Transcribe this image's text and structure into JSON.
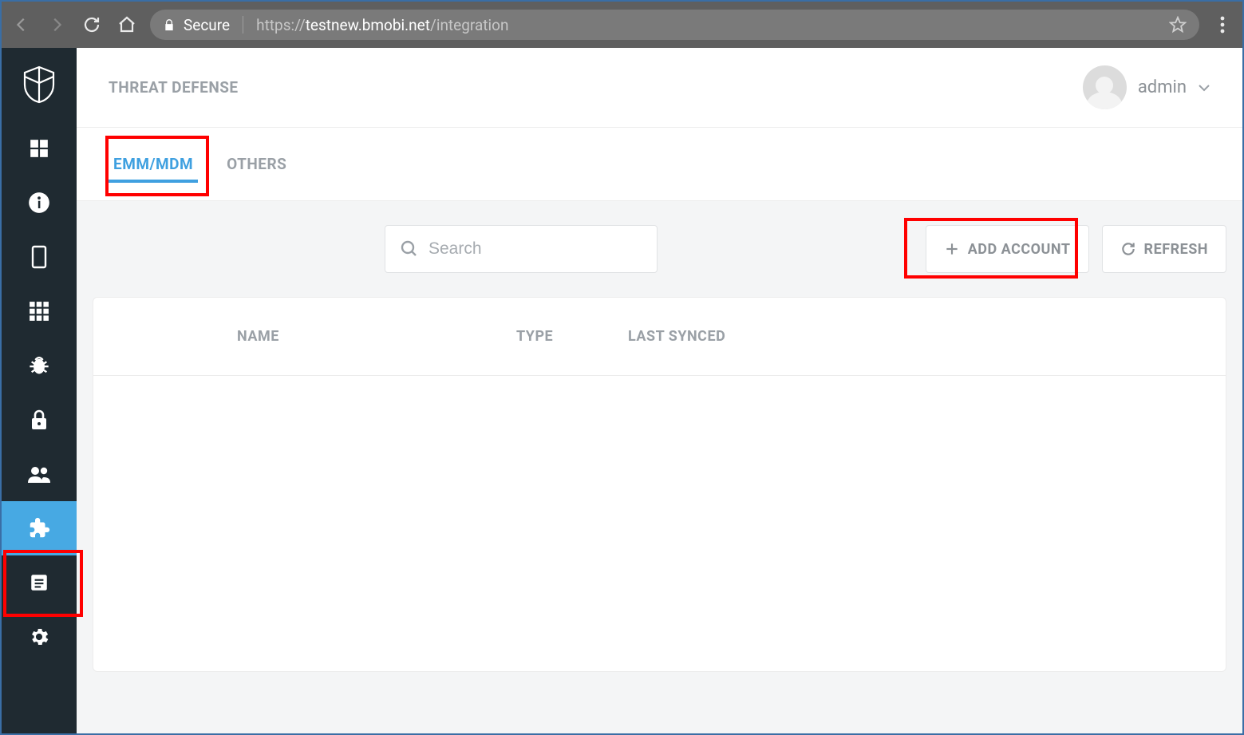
{
  "browser": {
    "secure_label": "Secure",
    "url_prefix": "https://",
    "url_host": "testnew.bmobi.net",
    "url_path": "/integration"
  },
  "sidebar": {
    "items": [
      {
        "name": "dashboard-icon"
      },
      {
        "name": "info-icon"
      },
      {
        "name": "device-icon"
      },
      {
        "name": "apps-grid-icon"
      },
      {
        "name": "bug-icon"
      },
      {
        "name": "lock-icon"
      },
      {
        "name": "users-icon"
      },
      {
        "name": "integration-icon",
        "active": true
      },
      {
        "name": "list-icon"
      },
      {
        "name": "settings-icon"
      }
    ]
  },
  "header": {
    "title": "THREAT DEFENSE",
    "user_label": "admin"
  },
  "tabs": [
    {
      "label": "EMM/MDM",
      "active": true
    },
    {
      "label": "OTHERS",
      "active": false
    }
  ],
  "toolbar": {
    "search_placeholder": "Search",
    "add_account_label": "ADD ACCOUNT",
    "refresh_label": "REFRESH"
  },
  "table": {
    "columns": [
      "NAME",
      "TYPE",
      "LAST SYNCED"
    ]
  }
}
